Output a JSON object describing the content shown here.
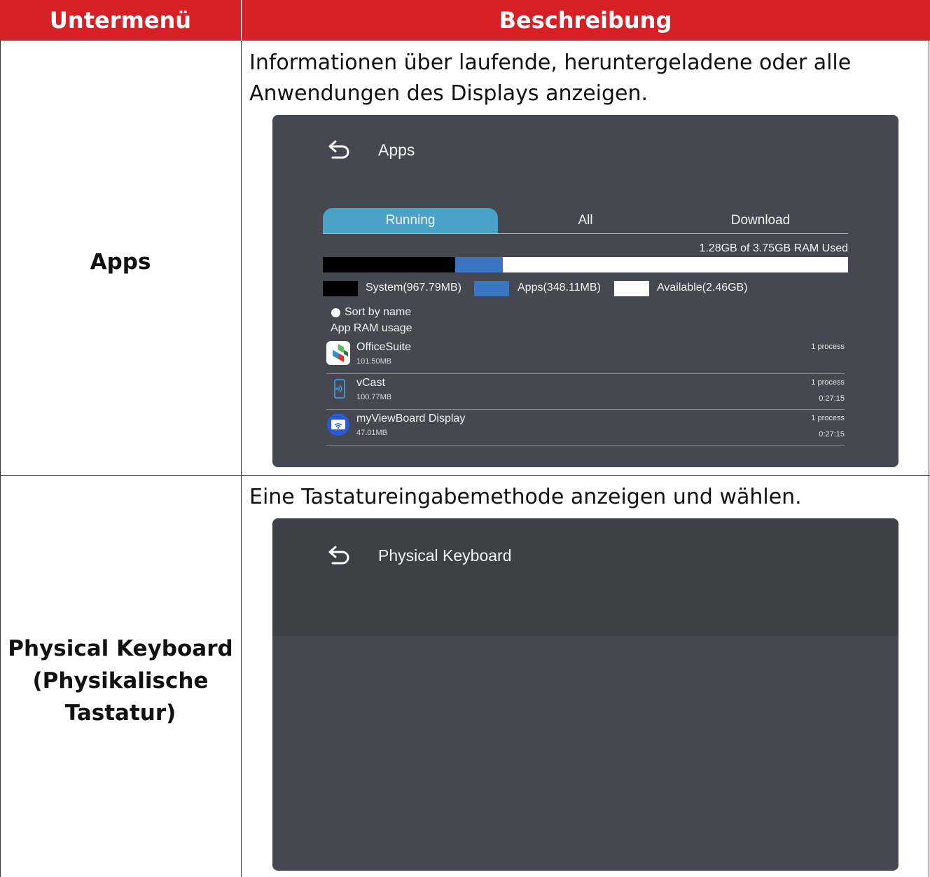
{
  "table": {
    "headers": [
      "Untermenü",
      "Beschreibung"
    ],
    "rows": [
      {
        "label": "Apps",
        "description": "Informationen über laufende, heruntergeladene oder alle Anwendungen des Displays anzeigen."
      },
      {
        "label_lines": [
          "Physical Keyboard",
          "(Physikalische",
          "Tastatur)"
        ],
        "description": "Eine Tastatureingabemethode anzeigen und wählen."
      }
    ]
  },
  "apps_screen": {
    "title": "Apps",
    "tabs": [
      {
        "label": "Running",
        "active": true
      },
      {
        "label": "All",
        "active": false
      },
      {
        "label": "Download",
        "active": false
      }
    ],
    "ram_used": "1.28GB of 3.75GB RAM Used",
    "ram_fractions": {
      "system": 0.252,
      "apps": 0.091,
      "available": 0.657
    },
    "legend": [
      {
        "label": "System(967.79MB)",
        "color": "#000000"
      },
      {
        "label": "Apps(348.11MB)",
        "color": "#3b76c2"
      },
      {
        "label": "Available(2.46GB)",
        "color": "#ffffff"
      }
    ],
    "sort_label": "Sort by name",
    "ram_usage_label": "App RAM usage",
    "apps": [
      {
        "name": "OfficeSuite",
        "size": "101.50MB",
        "processes": "1 process",
        "time": "",
        "icon": "officesuite-icon"
      },
      {
        "name": "vCast",
        "size": "100.77MB",
        "processes": "1 process",
        "time": "0:27:15",
        "icon": "vcast-icon"
      },
      {
        "name": "myViewBoard Display",
        "size": "47.01MB",
        "processes": "1 process",
        "time": "0:27:15",
        "icon": "myviewboard-display-icon"
      }
    ]
  },
  "keyboard_screen": {
    "title": "Physical Keyboard"
  },
  "colors": {
    "header_red": "#d71f26",
    "panel_bg": "#464851",
    "panel_header_bg": "#3e4048",
    "tab_active": "#4aa3c7",
    "apps_blue": "#3b76c2"
  }
}
